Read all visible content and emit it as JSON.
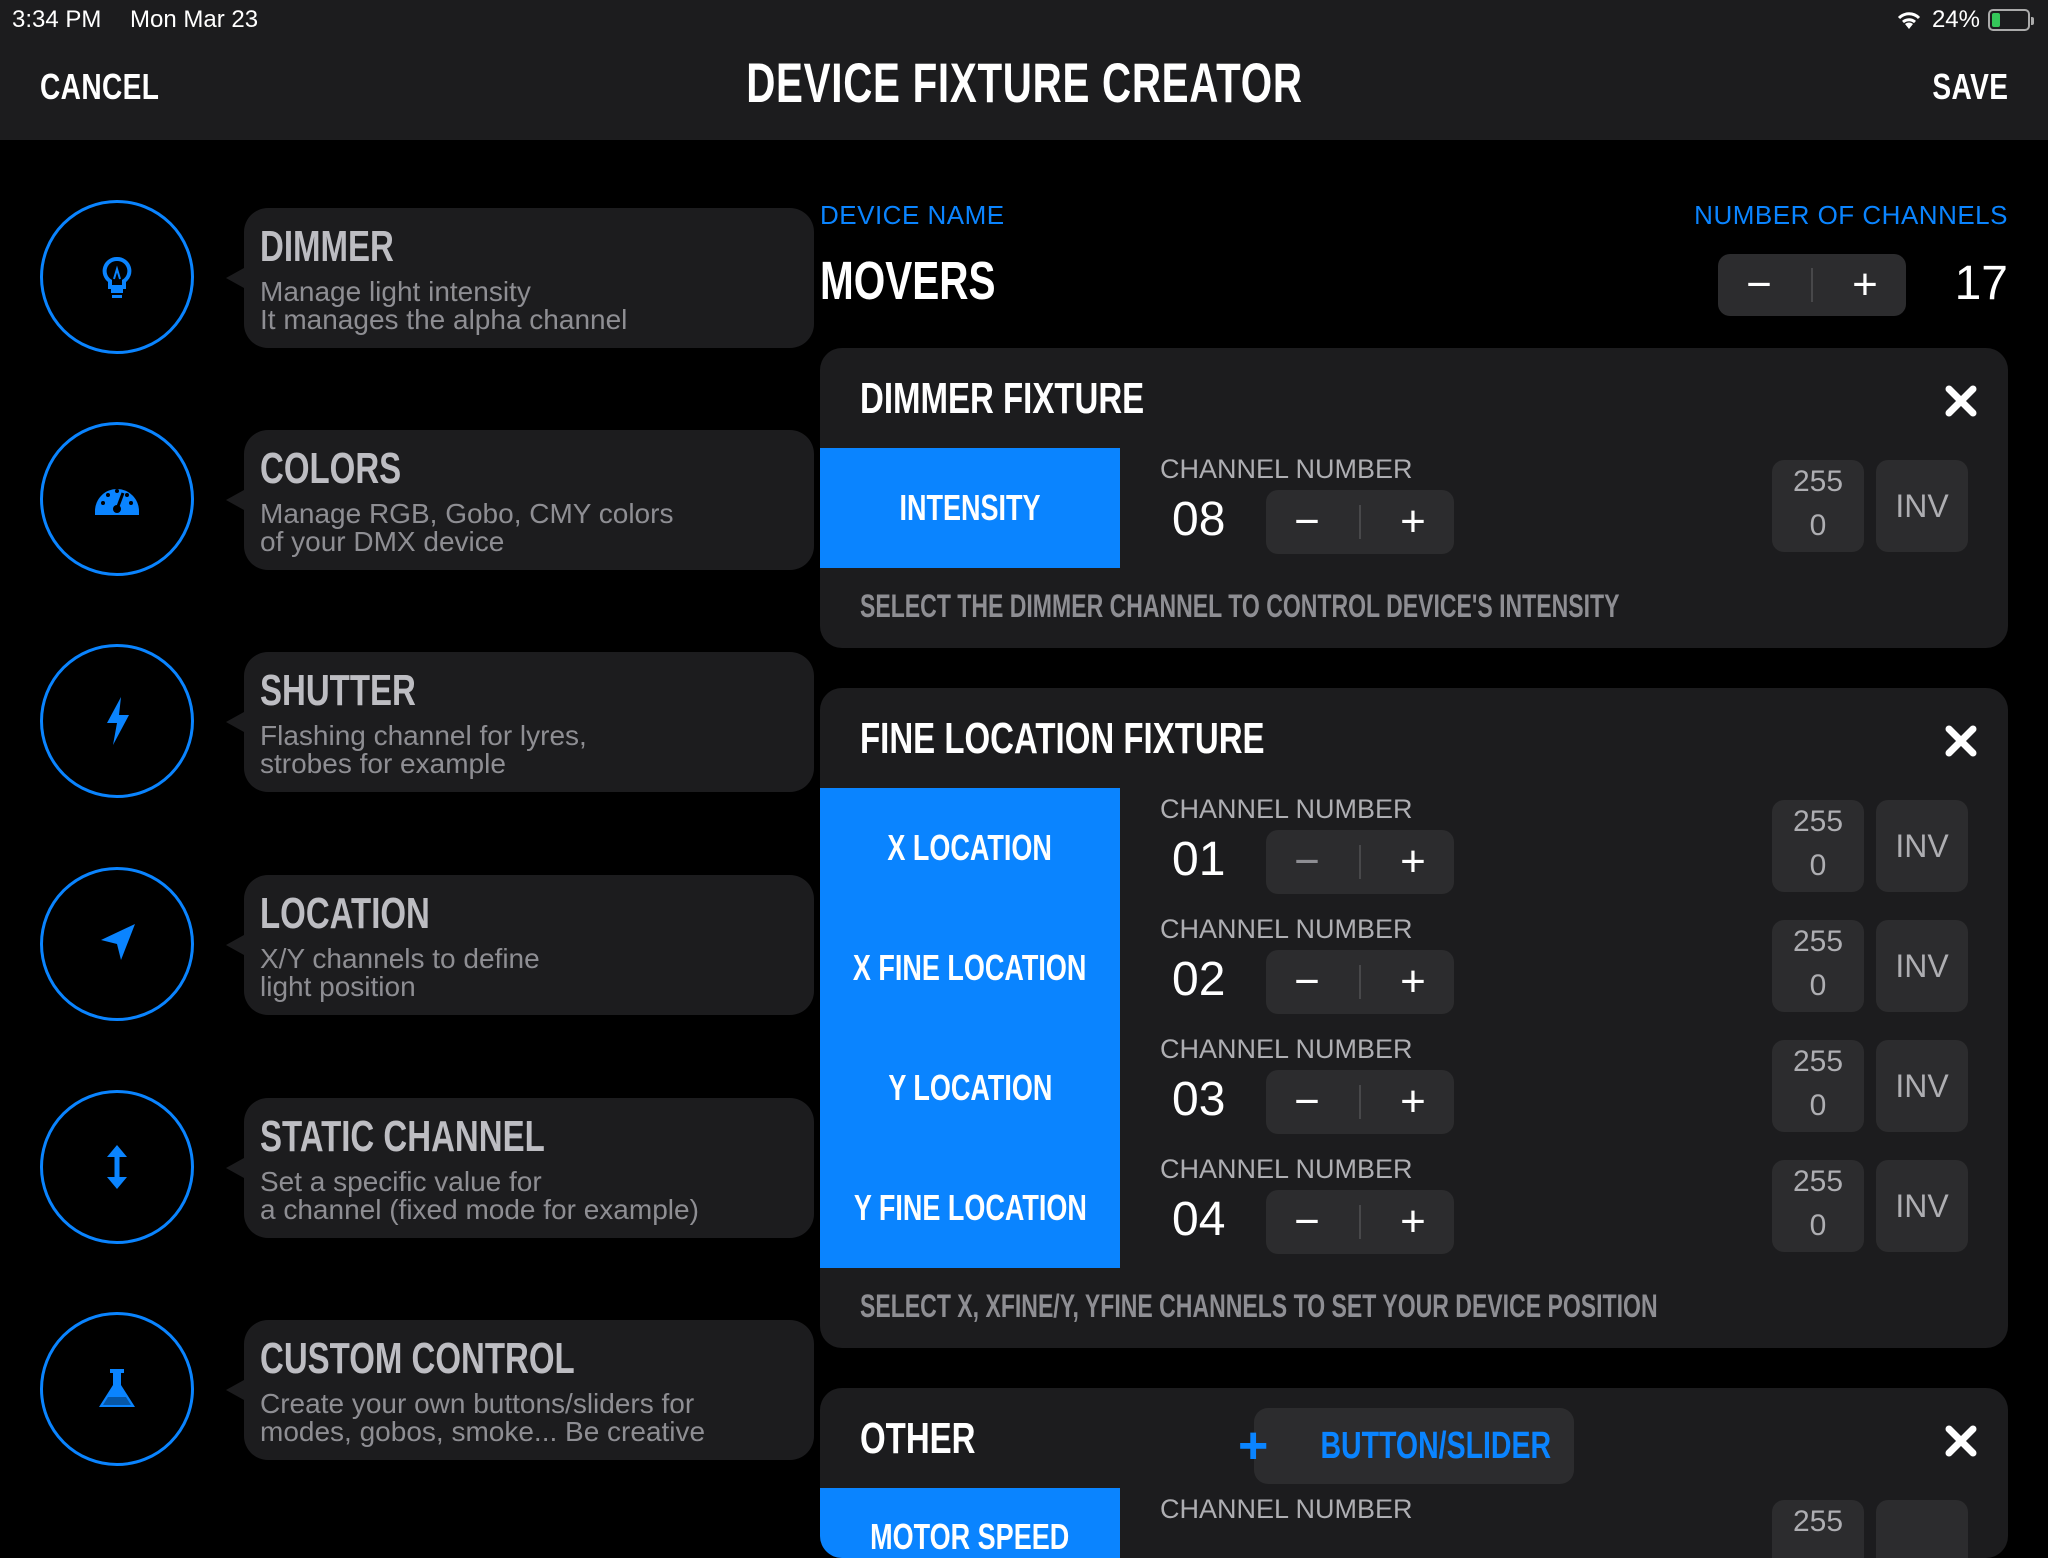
{
  "status_bar": {
    "time": "3:34 PM",
    "date": "Mon Mar 23",
    "battery_text": "24%",
    "battery_level_pct": 24
  },
  "nav": {
    "cancel": "CANCEL",
    "title": "DEVICE FIXTURE CREATOR",
    "save": "SAVE"
  },
  "sidebar": {
    "items": [
      {
        "title": "DIMMER",
        "desc": "Manage light intensity\nIt manages the alpha channel",
        "icon": "lightbulb-icon"
      },
      {
        "title": "COLORS",
        "desc": "Manage RGB, Gobo, CMY colors\nof your DMX device",
        "icon": "gauge-icon"
      },
      {
        "title": "SHUTTER",
        "desc": "Flashing channel for lyres,\nstrobes for example",
        "icon": "bolt-icon"
      },
      {
        "title": "LOCATION",
        "desc": "X/Y channels to define\nlight position",
        "icon": "location-arrow-icon"
      },
      {
        "title": "STATIC CHANNEL",
        "desc": "Set a specific value for\na channel (fixed mode for example)",
        "icon": "vertical-arrows-icon"
      },
      {
        "title": "CUSTOM CONTROL",
        "desc": "Create your own buttons/sliders for\nmodes, gobos, smoke... Be creative",
        "icon": "flask-icon"
      }
    ]
  },
  "device": {
    "name_label": "DEVICE NAME",
    "name": "MOVERS",
    "channels_label": "NUMBER OF CHANNELS",
    "channels": "17",
    "minus": "−",
    "plus": "+"
  },
  "fixtures": {
    "dimmer": {
      "title": "DIMMER FIXTURE",
      "rows": [
        {
          "name": "INTENSITY",
          "label": "CHANNEL NUMBER",
          "channel": "08",
          "max": "255",
          "min": "0",
          "inv": "INV"
        }
      ],
      "hint": "SELECT THE DIMMER CHANNEL TO CONTROL DEVICE'S INTENSITY"
    },
    "location": {
      "title": "FINE LOCATION FIXTURE",
      "rows": [
        {
          "name": "X LOCATION",
          "label": "CHANNEL NUMBER",
          "channel": "01",
          "max": "255",
          "min": "0",
          "inv": "INV"
        },
        {
          "name": "X FINE LOCATION",
          "label": "CHANNEL NUMBER",
          "channel": "02",
          "max": "255",
          "min": "0",
          "inv": "INV"
        },
        {
          "name": "Y LOCATION",
          "label": "CHANNEL NUMBER",
          "channel": "03",
          "max": "255",
          "min": "0",
          "inv": "INV"
        },
        {
          "name": "Y FINE LOCATION",
          "label": "CHANNEL NUMBER",
          "channel": "04",
          "max": "255",
          "min": "0",
          "inv": "INV"
        }
      ],
      "hint": "SELECT X, XFINE/Y, YFINE CHANNELS TO SET YOUR DEVICE POSITION"
    },
    "other": {
      "title": "OTHER",
      "add_button": "BUTTON/SLIDER",
      "rows": [
        {
          "name": "MOTOR SPEED",
          "label": "CHANNEL NUMBER",
          "max": "255"
        }
      ]
    }
  },
  "colors": {
    "accent": "#0a84ff",
    "card": "#1c1c1e",
    "control": "#2c2c2e"
  }
}
